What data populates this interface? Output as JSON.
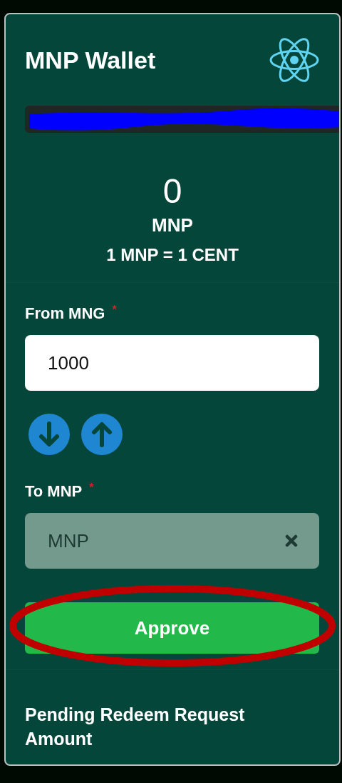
{
  "wallet": {
    "title": "MNP Wallet",
    "address": {
      "redacted": true
    }
  },
  "balance": {
    "amount": "0",
    "unit": "MNP",
    "rate": "1 MNP = 1 CENT"
  },
  "from_field": {
    "label": "From MNG",
    "required_mark": "*",
    "value": "1000"
  },
  "direction_buttons": [
    {
      "kind": "down"
    },
    {
      "kind": "up"
    }
  ],
  "to_field": {
    "label": "To MNP",
    "required_mark": "*",
    "value": "MNP",
    "disabled": true
  },
  "approve_button": {
    "label": "Approve",
    "circled": true
  },
  "pending": {
    "heading": "Pending Redeem Request Amount"
  }
}
